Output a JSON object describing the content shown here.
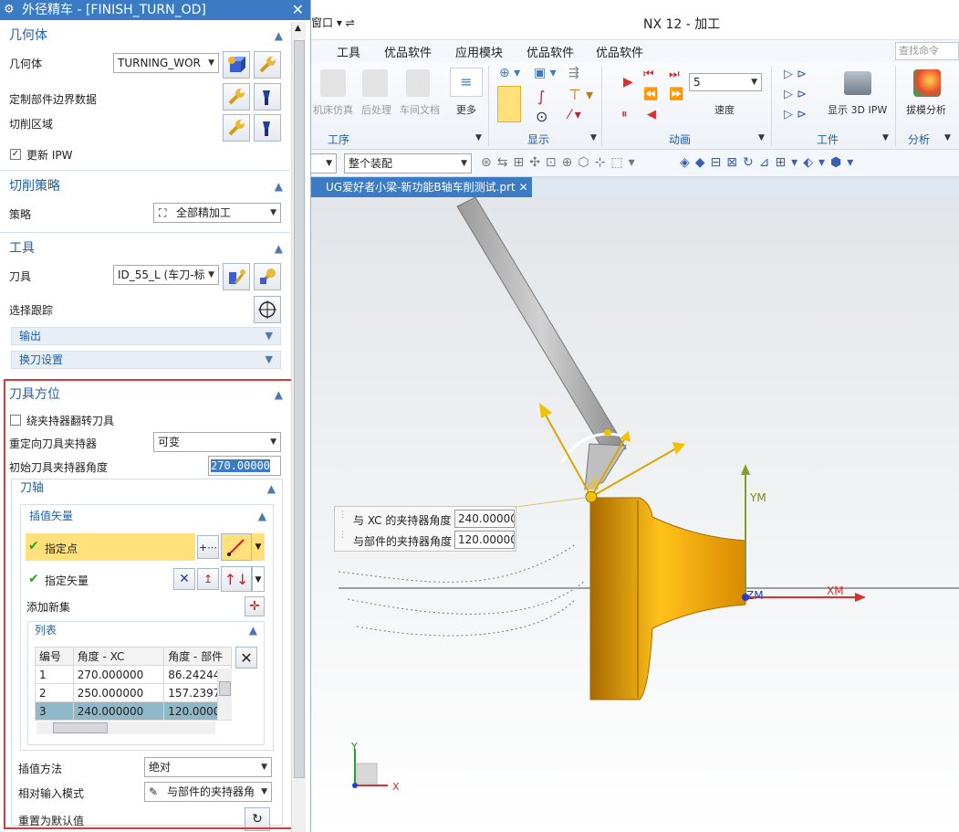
{
  "dialog": {
    "title": "外径精车 - [FINISH_TURN_OD]",
    "geometry": {
      "header": "几何体",
      "geometry_label": "几何体",
      "geometry_value": "TURNING_WOR",
      "boundary_label": "定制部件边界数据",
      "cut_region_label": "切削区域",
      "update_ipw_label": "更新 IPW"
    },
    "strategy": {
      "header": "切削策略",
      "strategy_label": "策略",
      "strategy_value": "全部精加工"
    },
    "tool": {
      "header": "工具",
      "tool_label": "刀具",
      "tool_value": "ID_55_L (车刀-标",
      "select_tracking_label": "选择跟踪",
      "output_label": "输出",
      "tool_change_label": "换刀设置"
    },
    "orientation": {
      "header": "刀具方位",
      "flip_label": "绕夹持器翻转刀具",
      "reorient_label": "重定向刀具夹持器",
      "reorient_value": "可变",
      "init_angle_label": "初始刀具夹持器角度",
      "init_angle_value": "270.00000",
      "tool_axis_header": "刀轴",
      "interp_vector_header": "插值矢量",
      "specify_point_label": "指定点",
      "specify_vector_label": "指定矢量",
      "add_new_set_label": "添加新集",
      "list_header": "列表",
      "table": {
        "columns": [
          "编号",
          "角度 - XC",
          "角度 - 部件"
        ],
        "rows": [
          [
            "1",
            "270.000000",
            "86.24244"
          ],
          [
            "2",
            "250.000000",
            "157.2397"
          ],
          [
            "3",
            "240.000000",
            "120.0000"
          ]
        ],
        "selected_row": 3
      },
      "interp_method_label": "插值方法",
      "interp_method_value": "绝对",
      "relative_mode_label": "相对输入模式",
      "relative_mode_value": "与部件的夹持器角",
      "reset_label": "重置为默认值"
    }
  },
  "nx": {
    "window_menu": "窗口",
    "title": "NX 12 - 加工",
    "menus": [
      "工具",
      "优品软件",
      "应用模块",
      "优品软件",
      "优品软件"
    ],
    "search_placeholder": "查找命令",
    "ribbon": {
      "machine_sim": "机床仿真",
      "post_process": "后处理",
      "shop_doc": "车间文档",
      "more": "更多",
      "group_operation": "工序",
      "group_display": "显示",
      "group_animation": "动画",
      "speed_value": "5",
      "speed_label": "速度",
      "show_3d_ipw": "显示 3D IPW",
      "draft_analysis": "拔模分析",
      "group_workpiece": "工件",
      "group_analysis": "分析"
    },
    "assembly_filter": "整个装配",
    "doc_tab": "UG爱好者小梁-新功能B轴车削测试.prt",
    "viewport": {
      "xc_angle_label": "与 XC 的夹持器角度",
      "xc_angle_value": "240.00000",
      "part_angle_label": "与部件的夹持器角度",
      "part_angle_value": "120.00000",
      "axis_ym": "YM",
      "axis_zm": "ZM",
      "axis_xm": "XM",
      "triad_y": "Y",
      "triad_x": "X"
    }
  }
}
